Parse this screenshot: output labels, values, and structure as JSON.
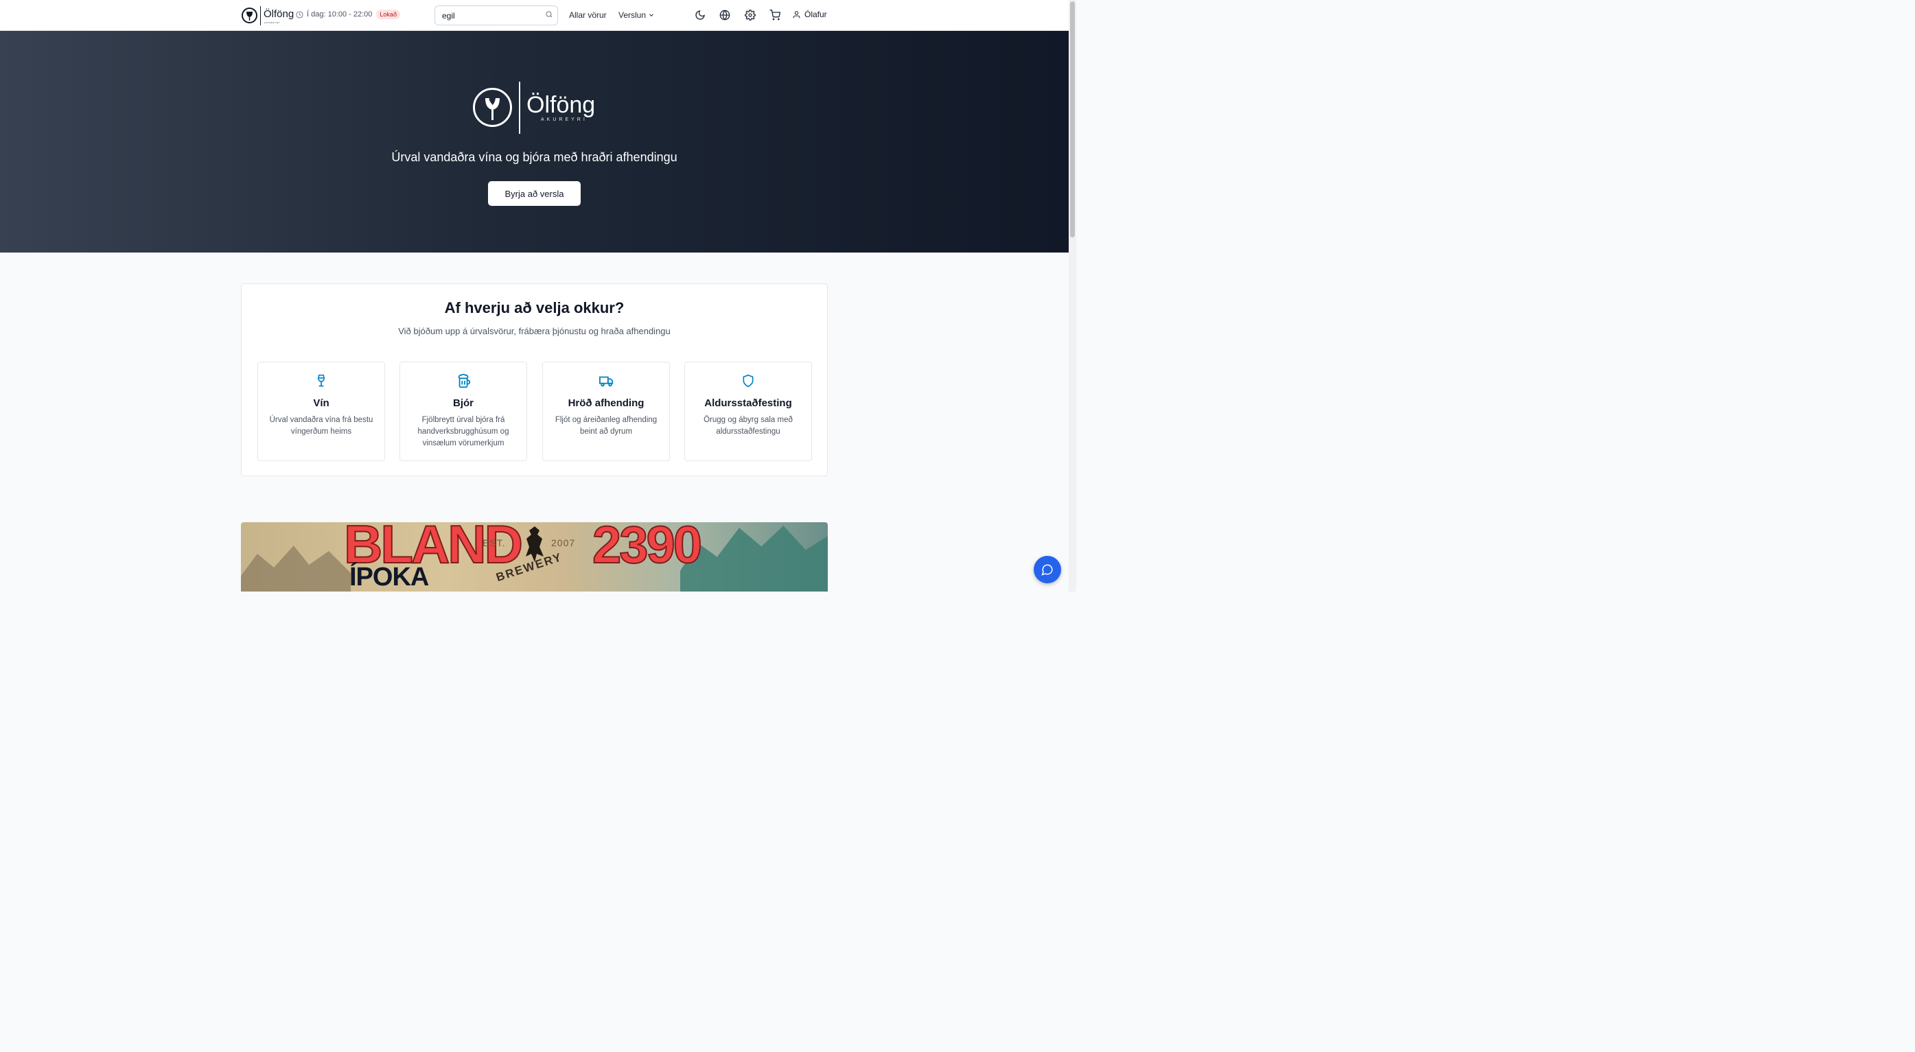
{
  "header": {
    "brand_name": "Ölföng",
    "brand_sub": "AKUREYRI",
    "hours_label": "Í dag: 10:00 - 22:00",
    "status_badge": "Lokað",
    "search_value": "egil",
    "nav_all_products": "Allar vörur",
    "nav_shop": "Verslun",
    "user_name": "Ólafur",
    "icons": [
      "clock-icon",
      "search-icon",
      "chevron-down-icon",
      "moon-icon",
      "globe-icon",
      "gear-icon",
      "cart-icon",
      "user-icon"
    ]
  },
  "hero": {
    "brand_name": "Ölföng",
    "brand_sub": "AKUREYRI",
    "tagline": "Úrval vandaðra vína og bjóra með hraðri afhendingu",
    "cta_label": "Byrja að versla"
  },
  "why": {
    "title": "Af hverju að velja okkur?",
    "lead": "Við bjóðum upp á úrvalsvörur, frábæra þjónustu og hraða afhendingu",
    "cards": [
      {
        "icon": "wine-glass-icon",
        "title": "Vín",
        "text": "Úrval vandaðra vína frá bestu víngerðum heims"
      },
      {
        "icon": "beer-mug-icon",
        "title": "Bjór",
        "text": "Fjölbreytt úrval bjóra frá handverksbrugghúsum og vinsælum vörumerkjum"
      },
      {
        "icon": "truck-icon",
        "title": "Hröð afhending",
        "text": "Fljót og áreiðanleg afhending beint að dyrum"
      },
      {
        "icon": "shield-icon",
        "title": "Aldursstaðfesting",
        "text": "Örugg og ábyrg sala með aldursstaðfestingu"
      }
    ]
  },
  "banner": {
    "headline": "BLAND",
    "subline": "ÍPOKA",
    "est": "EST.",
    "year": "2007",
    "brewery": "BREWERY",
    "price": "2390"
  },
  "colors": {
    "accent": "#0284c7",
    "badge_bg": "#fee2e2",
    "badge_text": "#b91c1c",
    "hero_dark": "#111827",
    "chat_button": "#2563eb"
  }
}
